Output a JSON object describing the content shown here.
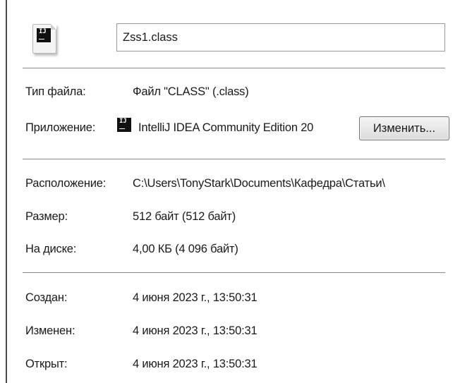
{
  "file": {
    "icon": "intellij-class-file-icon",
    "name": "Zss1.class"
  },
  "type": {
    "label": "Тип файла:",
    "value": "Файл \"CLASS\" (.class)"
  },
  "application": {
    "label": "Приложение:",
    "icon": "intellij-idea-icon",
    "icon_text": "IJ",
    "value": "IntelliJ IDEA Community Edition 20",
    "change_button": "Изменить..."
  },
  "location": {
    "label": "Расположение:",
    "value": "C:\\Users\\TonyStark\\Documents\\Кафедра\\Статьи\\"
  },
  "size": {
    "label": "Размер:",
    "value": "512 байт (512 байт)"
  },
  "disk_size": {
    "label": "На диске:",
    "value": "4,00 КБ (4 096 байт)"
  },
  "created": {
    "label": "Создан:",
    "value": "4 июня 2023 г., 13:50:31"
  },
  "modified": {
    "label": "Изменен:",
    "value": "4 июня 2023 г., 13:50:31"
  },
  "accessed": {
    "label": "Открыт:",
    "value": "4 июня 2023 г., 13:50:31"
  }
}
